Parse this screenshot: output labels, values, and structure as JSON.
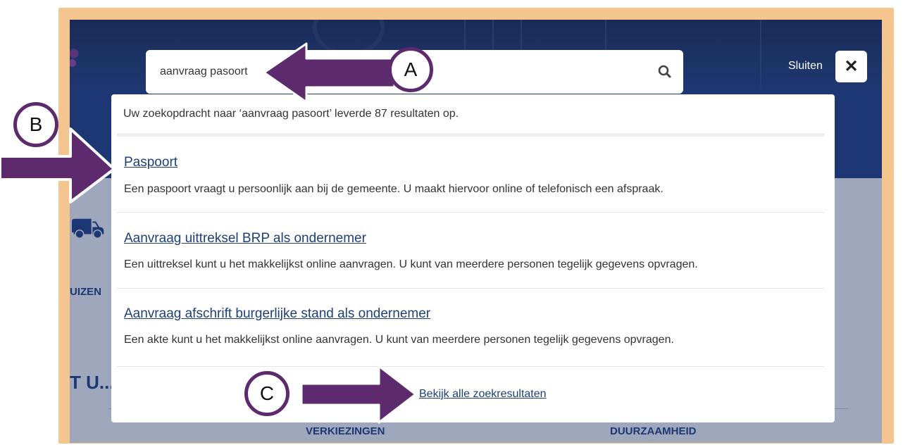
{
  "search": {
    "value": "aanvraag pasoort",
    "icon": "search-icon"
  },
  "close": {
    "label": "Sluiten",
    "icon_glyph": "✕"
  },
  "results": {
    "summary": "Uw zoekopdracht naar ‘aanvraag pasoort’ leverde 87 resultaten op.",
    "items": [
      {
        "title": "Paspoort",
        "description": "Een paspoort vraagt u persoonlijk aan bij de gemeente. U maakt hiervoor online of telefonisch een afspraak."
      },
      {
        "title": "Aanvraag uittreksel BRP als ondernemer",
        "description": "Een uittreksel kunt u het makkelijkst online aanvragen. U kunt van meerdere personen tegelijk gegevens opvragen."
      },
      {
        "title": "Aanvraag afschrift burgerlijke stand als ondernemer",
        "description": "Een akte kunt u het makkelijkst online aanvragen. U kunt van meerdere personen tegelijk gegevens opvragen."
      }
    ],
    "view_all": "Bekijk alle zoekresultaten"
  },
  "background": {
    "side_label": "UIZEN",
    "side_heading": "T U...",
    "tabs": [
      "VERKIEZINGEN",
      "DUURZAAMHEID"
    ]
  },
  "annotations": {
    "a": "A",
    "b": "B",
    "c": "C"
  },
  "colors": {
    "frame": "#f4c58e",
    "brand_blue": "#1f3f82",
    "annotation_purple": "#5e2a6e",
    "link": "#1f3f7a"
  }
}
